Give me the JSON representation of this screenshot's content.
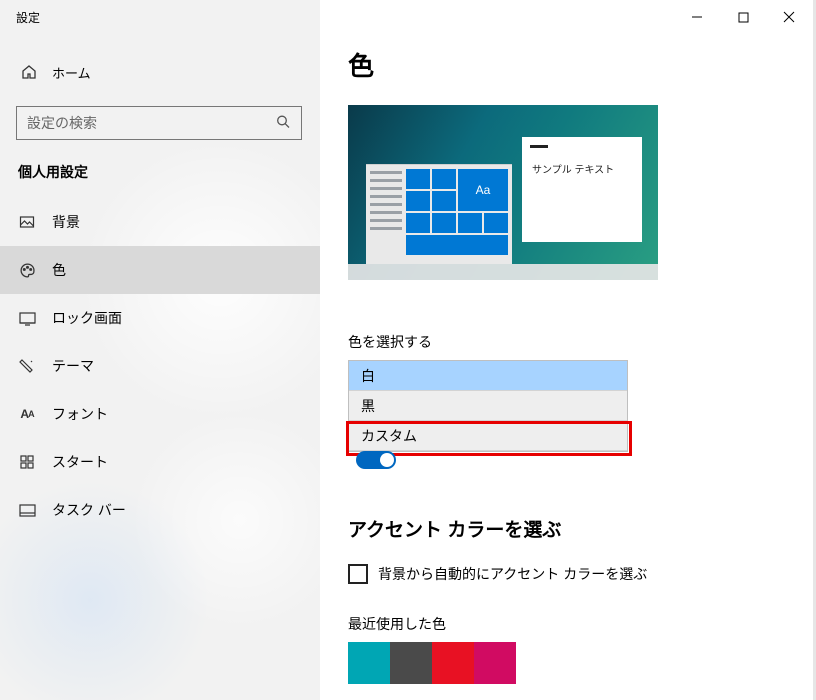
{
  "app_title": "設定",
  "home_label": "ホーム",
  "search": {
    "placeholder": "設定の検索"
  },
  "group_header": "個人用設定",
  "nav": [
    {
      "key": "background",
      "label": "背景"
    },
    {
      "key": "colors",
      "label": "色"
    },
    {
      "key": "lockscreen",
      "label": "ロック画面"
    },
    {
      "key": "themes",
      "label": "テーマ"
    },
    {
      "key": "fonts",
      "label": "フォント"
    },
    {
      "key": "start",
      "label": "スタート"
    },
    {
      "key": "taskbar",
      "label": "タスク バー"
    }
  ],
  "selected_nav": "colors",
  "page": {
    "title": "色",
    "preview": {
      "sample_text": "サンプル テキスト",
      "tile_text": "Aa"
    },
    "choose_color": {
      "label": "色を選択する",
      "options": [
        "白",
        "黒",
        "カスタム"
      ],
      "highlighted": "白",
      "emphasized": "カスタム"
    },
    "accent": {
      "heading": "アクセント カラーを選ぶ",
      "auto_checkbox_label": "背景から自動的にアクセント カラーを選ぶ",
      "auto_checked": false
    },
    "recent": {
      "label": "最近使用した色",
      "colors": [
        "#00a6b4",
        "#4a4a4a",
        "#e81123",
        "#d10b62"
      ]
    }
  }
}
